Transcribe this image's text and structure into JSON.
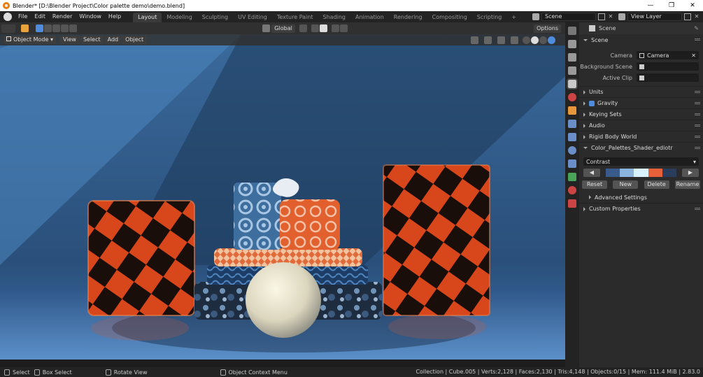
{
  "window": {
    "title": "Blender* [D:\\Blender Project\\Color palette demo\\demo.blend]",
    "minimize": "—",
    "maximize": "❒",
    "close": "✕"
  },
  "menu": [
    "File",
    "Edit",
    "Render",
    "Window",
    "Help"
  ],
  "workspaces": [
    "Layout",
    "Modeling",
    "Sculpting",
    "UV Editing",
    "Texture Paint",
    "Shading",
    "Animation",
    "Rendering",
    "Compositing",
    "Scripting"
  ],
  "workspace_add": "+",
  "scene_name": "Scene",
  "view_layer": "View Layer",
  "viewport_header": {
    "transform_orientation": "Global",
    "options_label": "Options",
    "mode": "Object Mode",
    "menus": [
      "View",
      "Select",
      "Add",
      "Object"
    ]
  },
  "properties": {
    "context": "Scene",
    "scene_section": "Scene",
    "camera_label": "Camera",
    "camera_value": "Camera",
    "background_scene_label": "Background Scene",
    "active_clip_label": "Active Clip",
    "sections": [
      "Units",
      "Gravity",
      "Keying Sets",
      "Audio",
      "Rigid Body World",
      "Color_Palettes_Shader_ediotr"
    ],
    "palette_name": "Contrast",
    "palette_colors": [
      "#3b5a8c",
      "#8ab4de",
      "#d9f2ff",
      "#e8603a",
      "#2a3d5c"
    ],
    "buttons": [
      "Reset",
      "New",
      "Delete",
      "Rename"
    ],
    "advanced": "Advanced Settings",
    "custom_props": "Custom Properties"
  },
  "statusbar": {
    "select": "Select",
    "box_select": "Box Select",
    "rotate": "Rotate View",
    "context_menu": "Object Context Menu",
    "stats": "Collection | Cube.005 | Verts:2,128 | Faces:2,130 | Tris:4,148 | Objects:0/15 | Mem: 111.4 MiB | 2.83.0"
  },
  "colors": {
    "accent": "#4f8cde",
    "orange": "#d8461b",
    "blue_bg": "#2a4f7a"
  }
}
